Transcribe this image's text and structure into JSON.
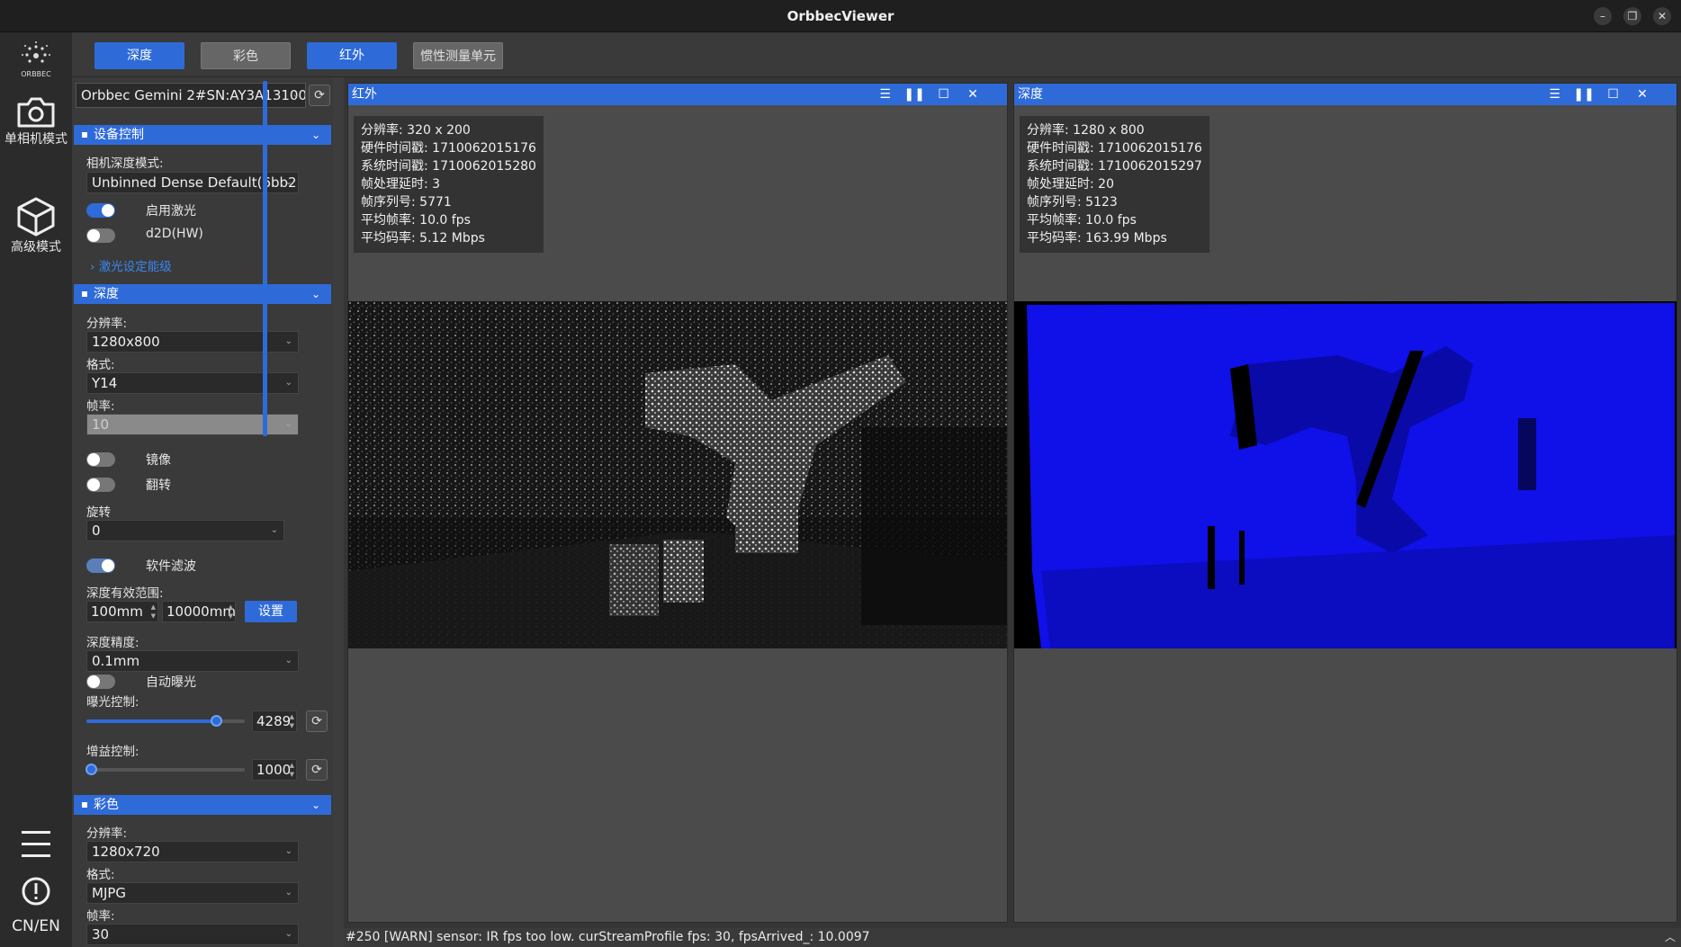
{
  "window": {
    "title": "OrbbecViewer",
    "controls": [
      "–",
      "❐",
      "✕"
    ]
  },
  "rail": {
    "logo_text": "ORBBEC",
    "modes": [
      {
        "label": "单相机模式",
        "icon": "camera-icon"
      },
      {
        "label": "高级模式",
        "icon": "cube-icon"
      }
    ],
    "lang": "CN/EN"
  },
  "toolbar": {
    "tabs": [
      {
        "label": "深度",
        "state": "active"
      },
      {
        "label": "彩色",
        "state": "inactive"
      },
      {
        "label": "红外",
        "state": "active"
      },
      {
        "label": "惯性测量单元",
        "state": "inactive"
      }
    ]
  },
  "panel": {
    "device": "Orbbec Gemini 2#SN:AY3A13100€",
    "device_control": {
      "title": "设备控制",
      "depth_mode_label": "相机深度模式:",
      "depth_mode_value": "Unbinned Dense Default(6bb2",
      "laser_label": "启用激光",
      "laser_on": true,
      "d2d_label": "d2D(HW)",
      "d2d_on": false,
      "laser_level_link": "激光设定能级"
    },
    "depth": {
      "title": "深度",
      "resolution_label": "分辨率:",
      "resolution": "1280x800",
      "format_label": "格式:",
      "format": "Y14",
      "fps_label": "帧率:",
      "fps": "10",
      "mirror_label": "镜像",
      "mirror_on": false,
      "flip_label": "翻转",
      "flip_on": false,
      "rotate_label": "旋转",
      "rotate": "0",
      "soft_filter_label": "软件滤波",
      "soft_filter_on": true,
      "range_label": "深度有效范围:",
      "range_min": "100mm",
      "range_max": "10000mm",
      "set_label": "设置",
      "precision_label": "深度精度:",
      "precision": "0.1mm",
      "auto_exposure_label": "自动曝光",
      "auto_exposure_on": false,
      "exposure_label": "曝光控制:",
      "exposure_value": "4289",
      "exposure_fraction": 0.82,
      "gain_label": "增益控制:",
      "gain_value": "1000",
      "gain_fraction": 0.03
    },
    "color": {
      "title": "彩色",
      "resolution_label": "分辨率:",
      "resolution": "1280x720",
      "format_label": "格式:",
      "format": "MJPG",
      "fps_label": "帧率:",
      "fps": "30"
    }
  },
  "views": [
    {
      "title": "红外",
      "info": [
        "分辨率: 320 x 200",
        "硬件时间戳: 1710062015176",
        "系统时间戳: 1710062015280",
        "帧处理延时: 3",
        "帧序列号: 5771",
        "平均帧率: 10.0 fps",
        "平均码率: 5.12 Mbps"
      ]
    },
    {
      "title": "深度",
      "info": [
        "分辨率: 1280 x 800",
        "硬件时间戳: 1710062015176",
        "系统时间戳: 1710062015297",
        "帧处理延时: 20",
        "帧序列号: 5123",
        "平均帧率: 10.0 fps",
        "平均码率: 163.99 Mbps"
      ]
    }
  ],
  "status": "#250 [WARN] sensor: IR fps too low. curStreamProfile fps: 30, fpsArrived_: 10.0097",
  "colors": {
    "accent": "#2f6bd8",
    "depth_blue": "#1414e6"
  }
}
